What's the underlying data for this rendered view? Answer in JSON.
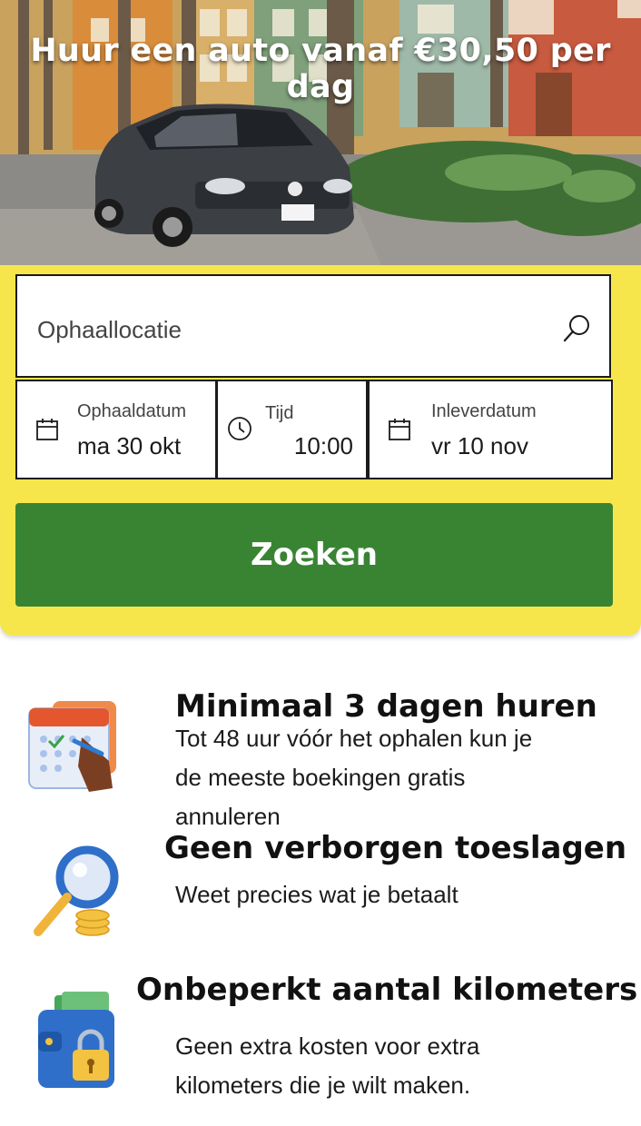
{
  "hero": {
    "title": "Huur een auto vanaf €30,50 per dag",
    "image": "car-on-palm-street-photo"
  },
  "search": {
    "location_placeholder": "Ophaallocatie",
    "pickup_date_label": "Ophaaldatum",
    "pickup_date_value": "ma 30 okt",
    "time_label": "Tijd",
    "time_value": "10:00",
    "return_date_label": "Inleverdatum",
    "return_date_value": "vr 10 nov",
    "submit_label": "Zoeken",
    "icons": [
      "search-icon",
      "calendar-icon",
      "clock-icon",
      "calendar-icon"
    ]
  },
  "features": [
    {
      "title": "Minimaal 3 dagen huren",
      "text_lines": [
        "Tot 48 uur vóór het ophalen kun je",
        "de meeste boekingen gratis",
        "annuleren"
      ],
      "icon": "calendar-illustration"
    },
    {
      "title": "Geen verborgen toeslagen",
      "text_lines": [
        "Weet precies wat je betaalt"
      ],
      "icon": "magnifier-coins-illustration"
    },
    {
      "title": "Onbeperkt aantal kilometers",
      "text_lines": [
        "Geen extra kosten voor extra",
        "kilometers die je wilt maken."
      ],
      "icon": "wallet-lock-illustration"
    }
  ],
  "colors": {
    "panel_yellow": "#f7e64b",
    "button_green": "#398433",
    "border": "#1b1b1b"
  }
}
